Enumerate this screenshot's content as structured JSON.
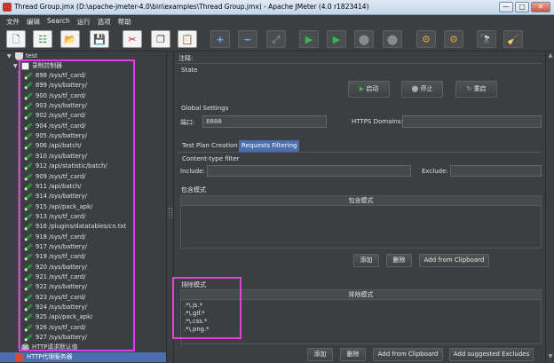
{
  "window": {
    "title": "Thread Group.jmx (D:\\apache-jmeter-4.0\\bin\\examples\\Thread Group.jmx) - Apache JMeter (4.0 r1823414)",
    "buttons": [
      "—",
      "□",
      "✕"
    ]
  },
  "menubar": [
    "文件",
    "编辑",
    "Search",
    "运行",
    "选项",
    "帮助"
  ],
  "toolbar": [
    {
      "name": "new-icon",
      "glyph": "🗋"
    },
    {
      "name": "templates-icon",
      "glyph": "☷"
    },
    {
      "name": "open-icon",
      "glyph": "📂"
    },
    {
      "name": "save-icon",
      "glyph": "💾"
    },
    {
      "name": "cut-icon",
      "glyph": "✂"
    },
    {
      "name": "copy-icon",
      "glyph": "❐"
    },
    {
      "name": "paste-icon",
      "glyph": "📋"
    },
    {
      "name": "expand-icon",
      "glyph": "+"
    },
    {
      "name": "collapse-icon",
      "glyph": "−"
    },
    {
      "name": "toggle-icon",
      "glyph": "⤢"
    },
    {
      "name": "start-icon",
      "glyph": "▶"
    },
    {
      "name": "start-no-pause-icon",
      "glyph": "▶"
    },
    {
      "name": "stop-icon",
      "glyph": "⬤"
    },
    {
      "name": "shutdown-icon",
      "glyph": "⬤"
    },
    {
      "name": "clear-icon",
      "glyph": "⚙"
    },
    {
      "name": "clear-all-icon",
      "glyph": "⚙"
    },
    {
      "name": "search-icon",
      "glyph": "🔭"
    },
    {
      "name": "reset-search-icon",
      "glyph": "🧹"
    }
  ],
  "tree": {
    "root": "test",
    "recorder": "录制控制器",
    "samplers": [
      "898 /sys/tf_card/",
      "899 /sys/battery/",
      "900 /sys/tf_card/",
      "903 /sys/battery/",
      "902 /sys/tf_card/",
      "904 /sys/tf_card/",
      "905 /sys/battery/",
      "906 /api/batch/",
      "910 /sys/battery/",
      "912 /api/statistic/batch/",
      "909 /sys/tf_card/",
      "911 /api/batch/",
      "914 /sys/battery/",
      "915 /api/pack_apk/",
      "913 /sys/tf_card/",
      "916 /plugins/datatables/cn.txt",
      "918 /sys/tf_card/",
      "917 /sys/battery/",
      "919 /sys/tf_card/",
      "920 /sys/battery/",
      "921 /sys/tf_card/",
      "922 /sys/battery/",
      "923 /sys/tf_card/",
      "924 /sys/battery/",
      "925 /api/pack_apk/",
      "926 /sys/tf_card/",
      "927 /sys/battery/"
    ],
    "defaults": "HTTP请求默认值",
    "proxy": "HTTP代理服务器"
  },
  "panel": {
    "comment_label": "注释:",
    "state_title": "State",
    "start_button": "启动",
    "stop_button": "停止",
    "restart_button": "重启",
    "global_title": "Global Settings",
    "port_label": "端口:",
    "port_value": "8888",
    "https_label": "HTTPS Domains:",
    "https_value": "",
    "tabs": [
      "Test Plan Creation",
      "Requests Filtering"
    ],
    "content_type_title": "Content-type filter",
    "include_label": "Include:",
    "include_value": "",
    "exclude_label": "Exclude:",
    "exclude_value": "",
    "include_pattern_title": "包含模式",
    "include_pattern_header": "包含模式",
    "add_button": "添加",
    "delete_button": "删除",
    "add_clipboard_button": "Add from Clipboard",
    "exclude_pattern_title": "排除模式",
    "exclude_pattern_header": "排除模式",
    "exclude_patterns": [
      ".*\\.js.*",
      ".*\\.gif.*",
      ".*\\.css.*",
      ".*\\.png.*"
    ],
    "add_button_2": "添加",
    "delete_button_2": "删除",
    "add_clipboard_button_2": "Add from Clipboard",
    "add_suggested_button": "Add suggested Excludes"
  },
  "colors": {
    "background": "#3c3f41",
    "selection": "#4b6eaf",
    "highlight": "#e040e0"
  }
}
